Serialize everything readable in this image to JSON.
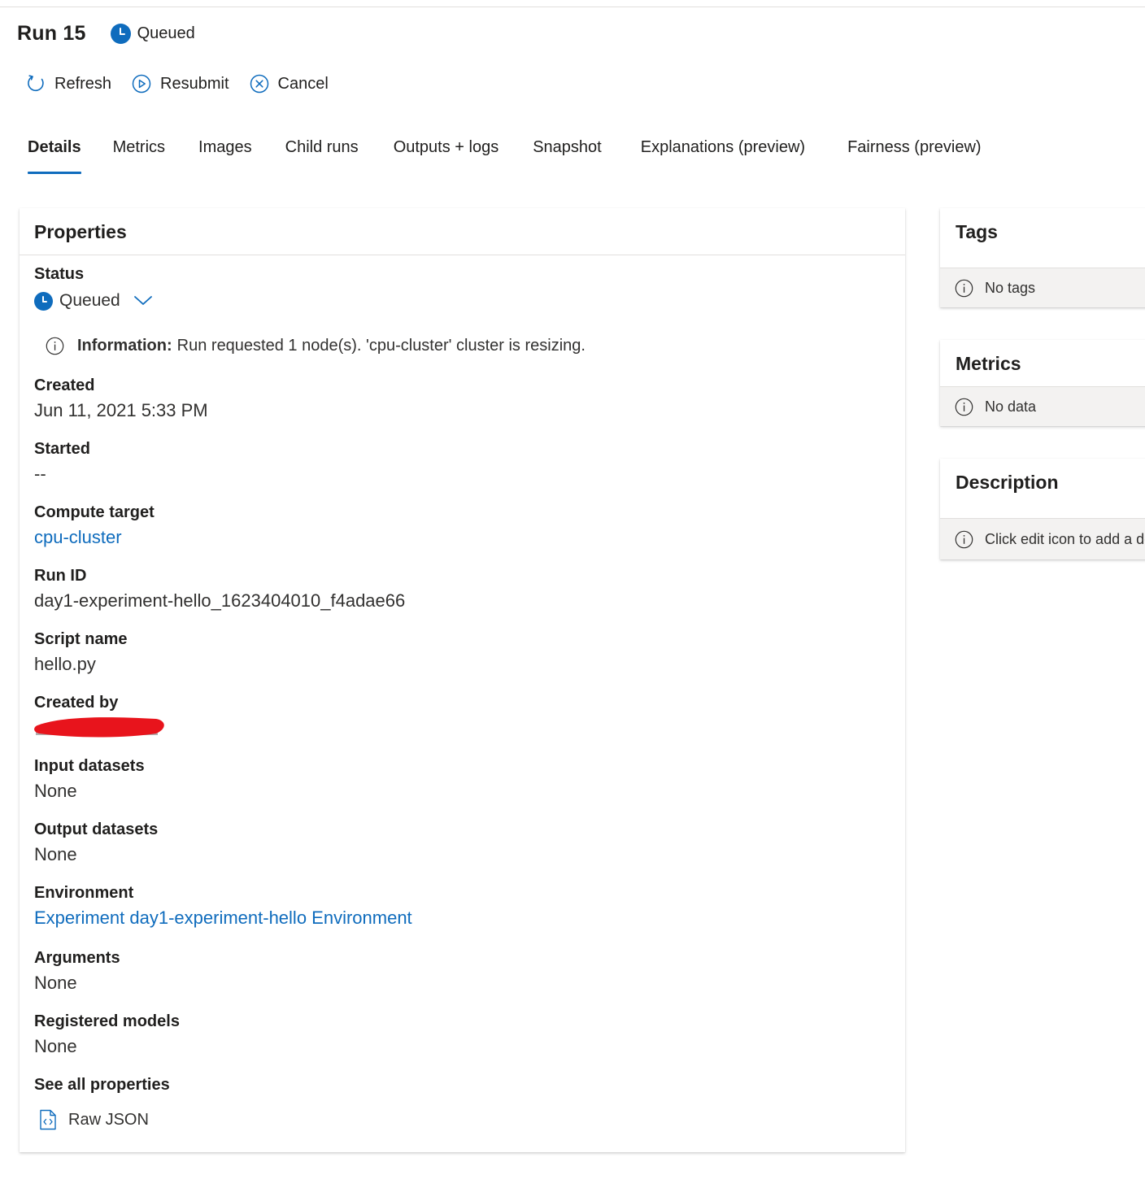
{
  "header": {
    "run_title": "Run 15",
    "status": "Queued"
  },
  "toolbar": {
    "refresh_label": "Refresh",
    "resubmit_label": "Resubmit",
    "cancel_label": "Cancel"
  },
  "tabs": [
    {
      "label": "Details",
      "active": true
    },
    {
      "label": "Metrics",
      "active": false
    },
    {
      "label": "Images",
      "active": false
    },
    {
      "label": "Child runs",
      "active": false
    },
    {
      "label": "Outputs + logs",
      "active": false
    },
    {
      "label": "Snapshot",
      "active": false
    },
    {
      "label": "Explanations (preview)",
      "active": false
    },
    {
      "label": "Fairness (preview)",
      "active": false
    }
  ],
  "properties": {
    "title": "Properties",
    "status_label": "Status",
    "status_value": "Queued",
    "info_label": "Information:",
    "info_text": "Run requested 1 node(s). 'cpu-cluster' cluster is resizing.",
    "created_label": "Created",
    "created_value": "Jun 11, 2021 5:33 PM",
    "started_label": "Started",
    "started_value": "--",
    "compute_target_label": "Compute target",
    "compute_target_value": "cpu-cluster",
    "run_id_label": "Run ID",
    "run_id_value": "day1-experiment-hello_1623404010_f4adae66",
    "script_name_label": "Script name",
    "script_name_value": "hello.py",
    "created_by_label": "Created by",
    "input_datasets_label": "Input datasets",
    "input_datasets_value": "None",
    "output_datasets_label": "Output datasets",
    "output_datasets_value": "None",
    "environment_label": "Environment",
    "environment_value": "Experiment day1-experiment-hello Environment",
    "arguments_label": "Arguments",
    "arguments_value": "None",
    "registered_models_label": "Registered models",
    "registered_models_value": "None",
    "see_all_label": "See all properties",
    "raw_json_label": "Raw JSON"
  },
  "tags_card": {
    "title": "Tags",
    "empty_text": "No tags"
  },
  "metrics_card": {
    "title": "Metrics",
    "empty_text": "No data"
  },
  "description_card": {
    "title": "Description",
    "empty_text": "Click edit icon to add a description"
  },
  "colors": {
    "accent": "#0f6cbd",
    "text": "#201f1e",
    "secondary_text": "#323130",
    "panel_bar": "#f3f2f1",
    "redaction": "#e8141c"
  }
}
